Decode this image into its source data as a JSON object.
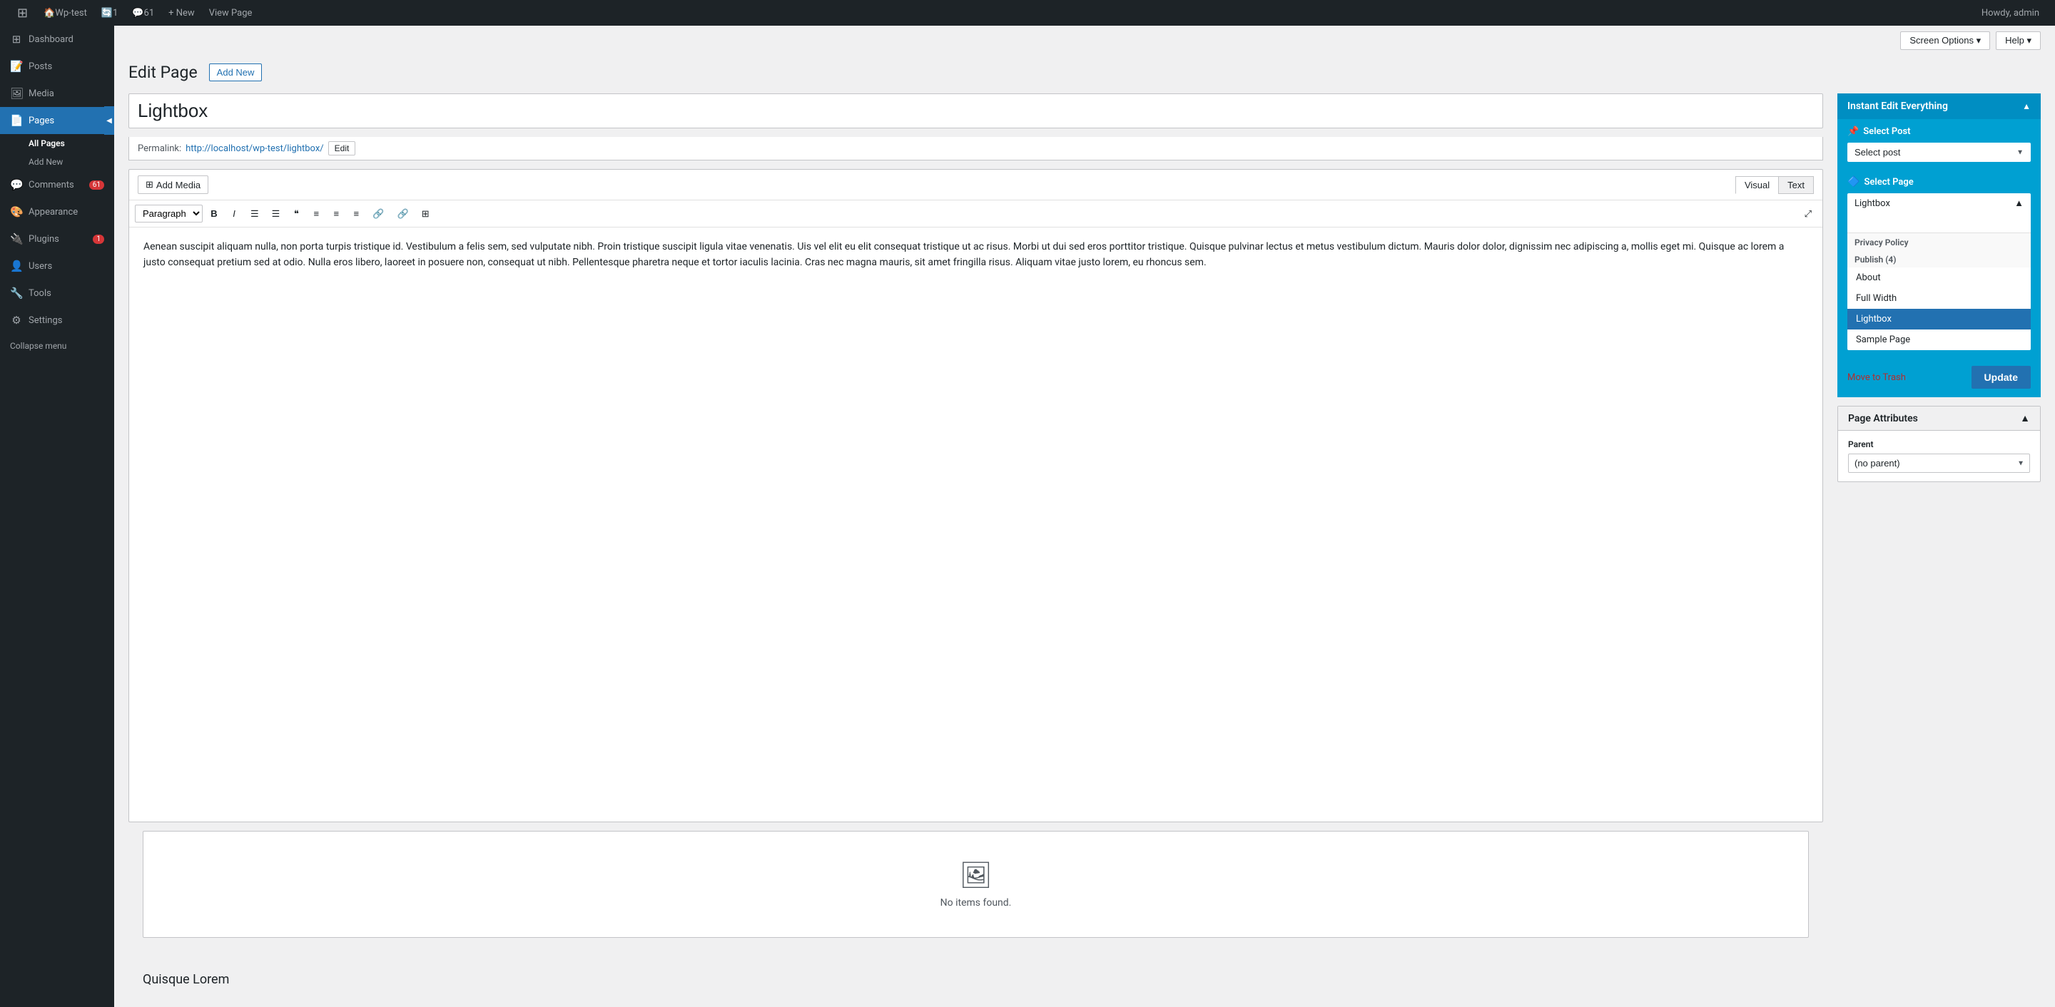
{
  "adminbar": {
    "logo": "⊞",
    "site_name": "Wp-test",
    "updates_count": "1",
    "comments_icon": "💬",
    "comments_count": "61",
    "new_label": "+ New",
    "view_page_label": "View Page",
    "howdy_label": "Howdy, admin"
  },
  "screen_options": {
    "label": "Screen Options ▾",
    "help_label": "Help ▾"
  },
  "sidebar": {
    "items": [
      {
        "id": "dashboard",
        "icon": "⊞",
        "label": "Dashboard"
      },
      {
        "id": "posts",
        "icon": "📝",
        "label": "Posts"
      },
      {
        "id": "media",
        "icon": "🖼",
        "label": "Media"
      },
      {
        "id": "pages",
        "icon": "📄",
        "label": "Pages",
        "active": true
      },
      {
        "id": "comments",
        "icon": "💬",
        "label": "Comments",
        "badge": "61"
      },
      {
        "id": "appearance",
        "icon": "🎨",
        "label": "Appearance"
      },
      {
        "id": "plugins",
        "icon": "🔌",
        "label": "Plugins",
        "badge": "1"
      },
      {
        "id": "users",
        "icon": "👤",
        "label": "Users"
      },
      {
        "id": "tools",
        "icon": "🔧",
        "label": "Tools"
      },
      {
        "id": "settings",
        "icon": "⚙",
        "label": "Settings"
      }
    ],
    "sub_items": [
      {
        "id": "all-pages",
        "label": "All Pages",
        "active": true
      },
      {
        "id": "add-new",
        "label": "Add New"
      }
    ],
    "collapse_label": "Collapse menu"
  },
  "page": {
    "title": "Edit Page",
    "add_new_label": "Add New",
    "post_title": "Lightbox",
    "permalink_label": "Permalink:",
    "permalink_url": "http://localhost/wp-test/lightbox/",
    "permalink_edit_label": "Edit",
    "add_media_label": "Add Media",
    "editor_visual_tab": "Visual",
    "editor_text_tab": "Text",
    "format_paragraph": "Paragraph",
    "format_bold": "B",
    "format_italic": "I",
    "format_ul": "≡",
    "format_ol": "≡",
    "format_quote": "❝",
    "format_align_left": "≡",
    "format_align_center": "≡",
    "format_align_right": "≡",
    "format_link": "🔗",
    "format_unlink": "🔗",
    "format_table": "⊞",
    "format_expand": "⤢",
    "editor_content": "Aenean suscipit aliquam nulla, non porta turpis tristique id. Vestibulum a felis sem, sed vulputate nibh. Proin tristique suscipit ligula vitae venenatis. Uis vel elit eu elit consequat tristique ut ac risus. Morbi ut dui sed eros porttitor tristique. Quisque pulvinar lectus et metus vestibulum dictum. Mauris dolor dolor, dignissim nec adipiscing a, mollis eget mi. Quisque ac lorem a justo consequat pretium sed at odio. Nulla eros libero, laoreet in posuere non, consequat ut nibh. Pellentesque pharetra neque et tortor iaculis lacinia. Cras nec magna mauris, sit amet fringilla risus. Aliquam vitae justo lorem, eu rhoncus sem.",
    "no_items_icon": "🖼",
    "no_items_label": "No items found.",
    "section_heading": "Quisque Lorem"
  },
  "instant_edit": {
    "title": "Instant Edit Everything",
    "toggle": "▲",
    "select_post_title": "📌 Select Post",
    "select_post_placeholder": "Select post",
    "select_page_title": "🔷 Select Page",
    "selected_page": "Lightbox",
    "search_placeholder": "",
    "dropdown_open": true,
    "privacy_label": "Privacy Policy",
    "publish_label": "Publish (4)",
    "pages": [
      {
        "id": "about",
        "label": "About"
      },
      {
        "id": "full-width",
        "label": "Full Width"
      },
      {
        "id": "lightbox",
        "label": "Lightbox",
        "selected": true
      },
      {
        "id": "sample-page",
        "label": "Sample Page"
      }
    ],
    "move_to_trash": "Move to Trash",
    "update_label": "Update"
  },
  "page_attributes": {
    "title": "Page Attributes",
    "toggle": "▲",
    "parent_label": "Parent",
    "parent_value": "(no parent)"
  }
}
